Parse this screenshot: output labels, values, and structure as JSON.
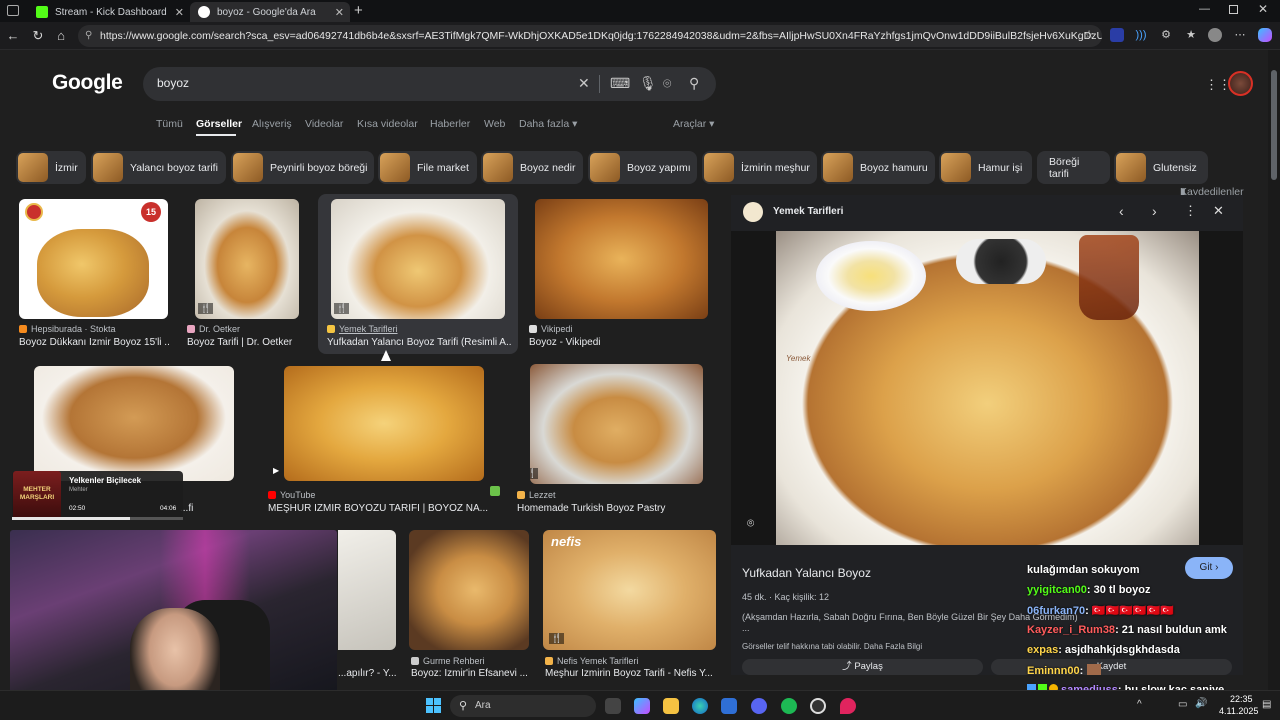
{
  "tabs": [
    {
      "title": "Stream - Kick Dashboard",
      "color": "#53fc18"
    },
    {
      "title": "boyoz - Google'da Ara",
      "color": "#4285f4"
    }
  ],
  "url": "https://www.google.com/search?sca_esv=ad06492741db6b4e&sxsrf=AE3TifMgk7QMF-WkDhjOXKAD5e1DKq0jdg:1762284942038&udm=2&fbs=AIljpHwSU0Xn4FRaYzhfgs1jmQvOnw1dDD9iiBulB2fsjeHv6XuKgDzU9KpxZMcpsjQNb1Wc...",
  "google": {
    "logo": "Google",
    "query": "boyoz",
    "nav": [
      "Tümü",
      "Görseller",
      "Alışveriş",
      "Videolar",
      "Kısa videolar",
      "Haberler",
      "Web",
      "Daha fazla ▾"
    ],
    "tools": "Araçlar ▾",
    "saved": "Kaydedilenler",
    "chips": [
      "İzmir",
      "Yalancı boyoz tarifi",
      "Peynirli boyoz böreği",
      "File market",
      "Boyoz nedir",
      "Boyoz yapımı",
      "İzmirin meşhur",
      "Boyoz hamuru",
      "Hamur işi",
      "Böreği tarifi",
      "Glutensiz"
    ]
  },
  "results": [
    {
      "source": "Hepsiburada · Stokta",
      "title": "Boyoz Dükkanı İzmir Boyoz 15'li ...",
      "badge": "15"
    },
    {
      "source": "Dr. Oetker",
      "title": "Boyoz Tarifi | Dr. Oetker"
    },
    {
      "source": "Yemek Tarifleri",
      "title": "Yufkadan Yalancı Boyoz Tarifi (Resimli A..."
    },
    {
      "source": "Vikipedi",
      "title": "Boyoz - Vikipedi"
    },
    {
      "source": "",
      "title": "...fi"
    },
    {
      "source": "YouTube",
      "title": "MEŞHUR İZMİR BOYOZU TARİFİ | BOYOZ NA..."
    },
    {
      "source": "Lezzet",
      "title": "Homemade Turkish Boyoz Pastry"
    },
    {
      "source": "",
      "title": "...apılır? - Y..."
    },
    {
      "source": "Gurme Rehberi",
      "title": "Boyoz: İzmir'in Efsanevi ..."
    },
    {
      "source": "Nefis Yemek Tarifleri",
      "title": "Meşhur İzmirin Boyoz Tarifi - Nefis Y...",
      "watermark": "nefis"
    }
  ],
  "panel": {
    "source": "Yemek Tarifleri",
    "title": "Yufkadan Yalancı Boyoz",
    "meta": "45 dk. · Kaç kişilik: 12",
    "desc": "(Akşamdan Hazırla, Sabah Doğru Fırına, Ben Böyle Güzel Bir Şey Daha Görmedim)",
    "ellipsis": "...",
    "copyright": "Görseller telif hakkına tabi olabilir.",
    "more": "Daha Fazla Bilgi",
    "go": "Git ›",
    "share": "Paylaş",
    "save": "Kaydet",
    "plate_label": "Yemek"
  },
  "music": {
    "title": "Yelkenler Biçilecek",
    "artist": "Mehter",
    "elapsed": "02:50",
    "total": "04:06",
    "art_text": "MEHTER MARŞLARI",
    "progress": 0.69
  },
  "chat": [
    {
      "user": "",
      "msg": "kulağımdan sokuyom",
      "color": "#ffffff"
    },
    {
      "user": "yyigitcan00",
      "msg": ": 30 tl boyoz",
      "color": "#53fc18"
    },
    {
      "user": "06furkan70",
      "msg": ":",
      "color": "#8ab4f8"
    },
    {
      "user": "Kayzer_i_Rum38",
      "msg": ": 21 nasıl buldun amk",
      "color": "#ff5c5c"
    },
    {
      "user": "expas",
      "msg": ": asjdhahkjdsgkhdasda",
      "color": "#ffd54a"
    },
    {
      "user": "Eminnn00",
      "msg": ":",
      "color": "#ffd54a"
    },
    {
      "user": "samediuss",
      "msg": ": bu slow kaç saniye",
      "color": "#b388ff"
    }
  ],
  "taskbar": {
    "search": "Ara",
    "time": "22:35",
    "date": "4.11.2025"
  }
}
